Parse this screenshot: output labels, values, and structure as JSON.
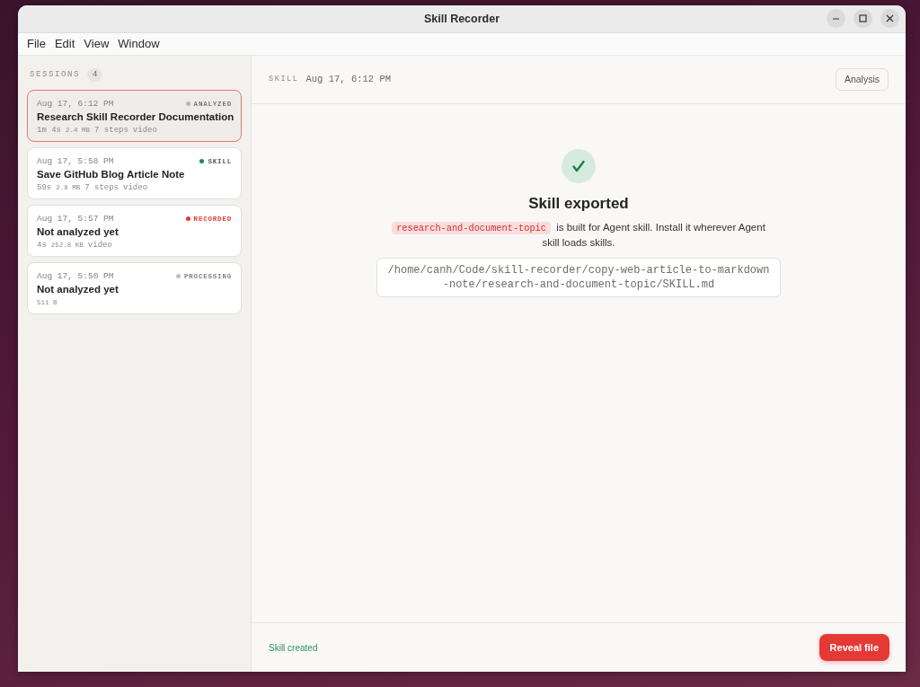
{
  "window": {
    "title": "Skill Recorder"
  },
  "menu": [
    "File",
    "Edit",
    "View",
    "Window"
  ],
  "sidebar": {
    "title": "SESSIONS",
    "count": "4",
    "sessions": [
      {
        "date": "Aug 17, 6:12 PM",
        "status": {
          "kind": "analyzed",
          "label": "ANALYZED",
          "color": "#b9b6b2"
        },
        "title": "Research Skill Recorder Documentation",
        "meta": [
          {
            "kind": "duration",
            "text": "1m 4s"
          },
          {
            "kind": "size",
            "text": "2.4 MB"
          },
          {
            "kind": "steps",
            "text": "7 steps"
          },
          {
            "kind": "type",
            "text": "video"
          }
        ],
        "selected": true
      },
      {
        "date": "Aug 17, 5:58 PM",
        "status": {
          "kind": "skill",
          "label": "SKILL",
          "color": "#1f8a55"
        },
        "title": "Save GitHub Blog Article Note",
        "meta": [
          {
            "kind": "duration",
            "text": "59s"
          },
          {
            "kind": "size",
            "text": "2.8 MB"
          },
          {
            "kind": "steps",
            "text": "7 steps"
          },
          {
            "kind": "type",
            "text": "video"
          }
        ],
        "selected": false
      },
      {
        "date": "Aug 17, 5:57 PM",
        "status": {
          "kind": "recorded",
          "label": "RECORDED",
          "color": "#e53935"
        },
        "title": "Not analyzed yet",
        "meta": [
          {
            "kind": "duration",
            "text": "4s"
          },
          {
            "kind": "size",
            "text": "252.8 KB"
          },
          {
            "kind": "type",
            "text": "video"
          }
        ],
        "selected": false
      },
      {
        "date": "Aug 17, 5:50 PM",
        "status": {
          "kind": "processing",
          "label": "PROCESSING",
          "color": "#c4c1bd"
        },
        "title": "Not analyzed yet",
        "meta": [
          {
            "kind": "size",
            "text": "511 B"
          }
        ],
        "selected": false
      }
    ]
  },
  "header": {
    "label": "SKILL",
    "date": "Aug 17, 6:12 PM",
    "button": "Analysis"
  },
  "result": {
    "title": "Skill exported",
    "skill_name": "research-and-document-topic",
    "description": "is built for Agent skill. Install it wherever Agent skill loads skills.",
    "path": "/home/canh/Code/skill-recorder/copy-web-article-to-markdown-note/research-and-document-topic/SKILL.md"
  },
  "footer": {
    "status": "Skill created",
    "button": "Reveal file"
  }
}
